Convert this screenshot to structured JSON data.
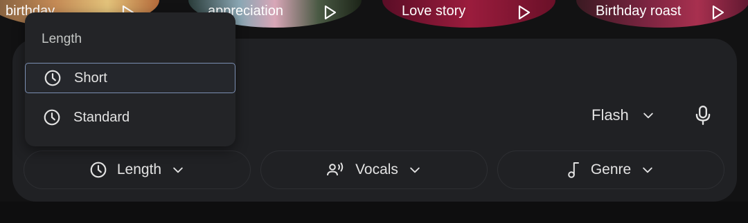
{
  "suggestions": [
    {
      "label": "birthday",
      "icon": "play-icon"
    },
    {
      "label": "appreciation",
      "icon": "play-icon"
    },
    {
      "label": "Love story",
      "icon": "play-icon"
    },
    {
      "label": "Birthday roast",
      "icon": "play-icon"
    }
  ],
  "composer": {
    "model_label": "Flash",
    "model_icon": "chevron-down-icon",
    "mic_icon": "microphone-icon"
  },
  "toolbar": {
    "length_label": "Length",
    "vocals_label": "Vocals",
    "genre_label": "Genre"
  },
  "length_menu": {
    "header": "Length",
    "items": [
      {
        "label": "Short",
        "selected": true,
        "icon": "clock-icon"
      },
      {
        "label": "Standard",
        "selected": false,
        "icon": "clock-icon"
      }
    ]
  },
  "colors": {
    "panel": "#202124",
    "background": "#121213",
    "selection_border": "#7c8fb3",
    "text": "#e3e3e3"
  }
}
